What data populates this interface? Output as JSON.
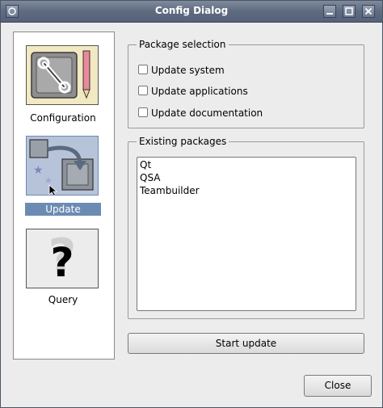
{
  "window": {
    "title": "Config Dialog"
  },
  "icons": {
    "items": [
      {
        "label": "Configuration",
        "icon": "configuration-icon"
      },
      {
        "label": "Update",
        "icon": "update-icon"
      },
      {
        "label": "Query",
        "icon": "query-icon"
      }
    ],
    "selected": "Update"
  },
  "package_selection": {
    "title": "Package selection",
    "options": [
      {
        "label": "Update system",
        "checked": false
      },
      {
        "label": "Update applications",
        "checked": false
      },
      {
        "label": "Update documentation",
        "checked": false
      }
    ]
  },
  "existing_packages": {
    "title": "Existing packages",
    "items": [
      "Qt",
      "QSA",
      "Teambuilder"
    ]
  },
  "buttons": {
    "start_update": "Start update",
    "close": "Close"
  },
  "colors": {
    "titlebar": "#5e6a7f",
    "selection": "#6c8bb3",
    "background": "#ececec"
  }
}
